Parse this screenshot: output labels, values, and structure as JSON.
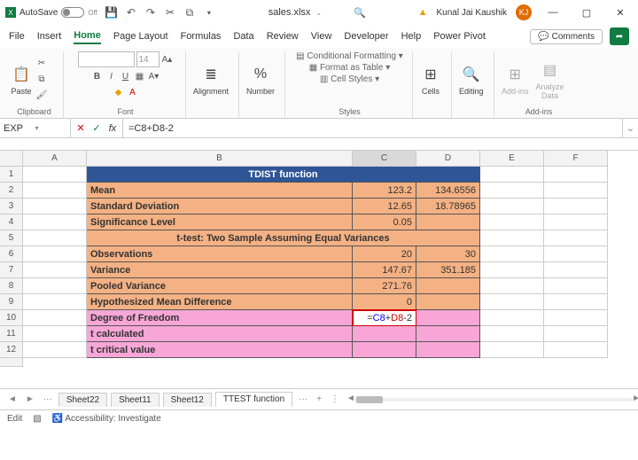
{
  "titlebar": {
    "autosave_label": "AutoSave",
    "autosave_state": "Off",
    "filename": "sales.xlsx",
    "user_name": "Kunal Jai Kaushik",
    "user_initials": "KJ"
  },
  "tabs": {
    "file": "File",
    "insert": "Insert",
    "home": "Home",
    "page_layout": "Page Layout",
    "formulas": "Formulas",
    "data": "Data",
    "review": "Review",
    "view": "View",
    "developer": "Developer",
    "help": "Help",
    "power_pivot": "Power Pivot",
    "comments": "Comments"
  },
  "ribbon": {
    "paste": "Paste",
    "clipboard": "Clipboard",
    "font_size": "14",
    "font": "Font",
    "alignment": "Alignment",
    "number": "Number",
    "cond_fmt": "Conditional Formatting",
    "as_table": "Format as Table",
    "cell_styles": "Cell Styles",
    "styles": "Styles",
    "cells": "Cells",
    "editing": "Editing",
    "addins": "Add-ins",
    "analyze": "Analyze Data",
    "addins_group": "Add-ins"
  },
  "formula_bar": {
    "name_box": "EXP",
    "formula_text": "=C8+D8-2"
  },
  "columns": [
    "A",
    "B",
    "C",
    "D",
    "E",
    "F"
  ],
  "rows": [
    {
      "n": 1,
      "type": "title",
      "text": "TDIST function"
    },
    {
      "n": 2,
      "type": "orange",
      "label": "Mean",
      "c": "123.2",
      "d": "134.6556"
    },
    {
      "n": 3,
      "type": "orange",
      "label": "Standard Deviation",
      "c": "12.65",
      "d": "18.78965"
    },
    {
      "n": 4,
      "type": "orange",
      "label": "Significance Level",
      "c": "0.05",
      "d": ""
    },
    {
      "n": 5,
      "type": "subtitle",
      "text": "t-test: Two Sample Assuming Equal Variances"
    },
    {
      "n": 6,
      "type": "orange",
      "label": "Observations",
      "c": "20",
      "d": "30"
    },
    {
      "n": 7,
      "type": "orange",
      "label": "Variance",
      "c": "147.67",
      "d": "351.185"
    },
    {
      "n": 8,
      "type": "orange",
      "label": "Pooled Variance",
      "c": "271.76",
      "d": ""
    },
    {
      "n": 9,
      "type": "orange",
      "label": "Hypothesized Mean Difference",
      "c": "0",
      "d": ""
    },
    {
      "n": 10,
      "type": "pink-active",
      "label": "Degree of Freedom",
      "formula_parts": [
        "=",
        "C8",
        "+",
        "D8",
        "-2"
      ]
    },
    {
      "n": 11,
      "type": "pink",
      "label": "t calculated"
    },
    {
      "n": 12,
      "type": "pink",
      "label": "t critical value"
    }
  ],
  "sheets": {
    "items": [
      "Sheet22",
      "Sheet11",
      "Sheet12",
      "TTEST function"
    ],
    "active": "TTEST function",
    "more": "···",
    "add": "+"
  },
  "status": {
    "mode": "Edit",
    "accessibility": "Accessibility: Investigate"
  }
}
